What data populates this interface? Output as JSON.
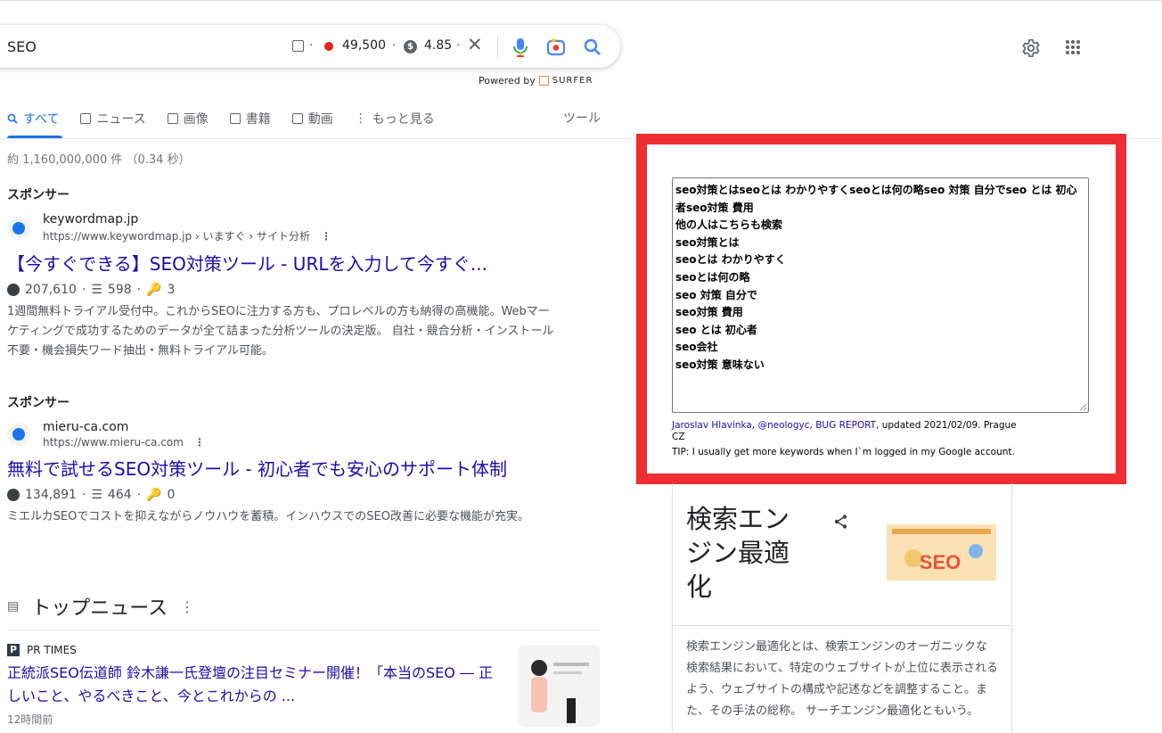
{
  "search": {
    "query": "SEO"
  },
  "surfer": {
    "volume": "49,500",
    "cpc": "4.85",
    "sep": "·",
    "powered_label": "Powered by",
    "brand": "SURFER"
  },
  "tabs": [
    {
      "label": "すべて",
      "icon": "search-icon",
      "active": true
    },
    {
      "label": "ニュース",
      "icon": "news-icon"
    },
    {
      "label": "画像",
      "icon": "image-icon"
    },
    {
      "label": "書籍",
      "icon": "book-icon"
    },
    {
      "label": "動画",
      "icon": "video-icon"
    },
    {
      "label": "もっと見る",
      "icon": "more-vert-icon"
    }
  ],
  "tools_label": "ツール",
  "stats": "約 1,160,000,000 件 （0.34 秒）",
  "ads": [
    {
      "sponsor": "スポンサー",
      "domain": "keywordmap.jp",
      "url": "https://www.keywordmap.jp › いますぐ › サイト分析",
      "title": "【今すぐできる】SEO対策ツール - URLを入力して今すぐ...",
      "metric1": "207,610",
      "metric2": "598",
      "metric3": "3",
      "desc": "1週間無料トライアル受付中。これからSEOに注力する方も、プロレベルの方も納得の高機能。Webマーケティングで成功するためのデータが全て詰まった分析ツールの決定版。 自社・競合分析・インストール不要・機会損失ワード抽出・無料トライアル可能。"
    },
    {
      "sponsor": "スポンサー",
      "domain": "mieru-ca.com",
      "url": "https://www.mieru-ca.com",
      "title": "無料で試せるSEO対策ツール - 初心者でも安心のサポート体制",
      "metric1": "134,891",
      "metric2": "464",
      "metric3": "0",
      "desc": "ミエルカSEOでコストを抑えながらノウハウを蓄積。インハウスでのSEO改善に必要な機能が充実。"
    }
  ],
  "top_news": {
    "heading": "トップニュース",
    "publisher": "PR TIMES",
    "title": "正統派SEO伝道師 鈴木謙一氏登壇の注目セミナー開催！「本当のSEO ― 正しいこと、やるべきこと、今とこれからの ...",
    "time": "12時間前"
  },
  "keywords_panel": {
    "lines": [
      "seo対策とはseoとは わかりやすくseoとは何の略seo 対策 自分でseo とは 初心者seo対策 費用",
      "他の人はこちらも検索",
      "seo対策とは",
      "seoとは わかりやすく",
      "seoとは何の略",
      "seo 対策 自分で",
      "seo対策 費用",
      "seo とは 初心者",
      "seo会社",
      "seo対策 意味ない"
    ],
    "credit_author": "Jaroslav Hlavinka",
    "credit_handle": "@neologyc",
    "credit_bug": "BUG REPORT",
    "credit_rest": ", updated 2021/02/09. Prague CZ",
    "tip": "TIP: I usually get more keywords when I`m logged in my Google account."
  },
  "knowledge_panel": {
    "title": "検索エンジン最適化",
    "desc": "検索エンジン最適化とは、検索エンジンのオーガニックな検索結果において、特定のウェブサイトが上位に表示されるよう、ウェブサイトの構成や記述などを調整すること。また、その手法の総称。 サーチエンジン最適化ともいう。"
  },
  "colors": {
    "accent": "#1a73e8",
    "link": "#1a0dab",
    "highlight_border": "#ee2e32"
  }
}
